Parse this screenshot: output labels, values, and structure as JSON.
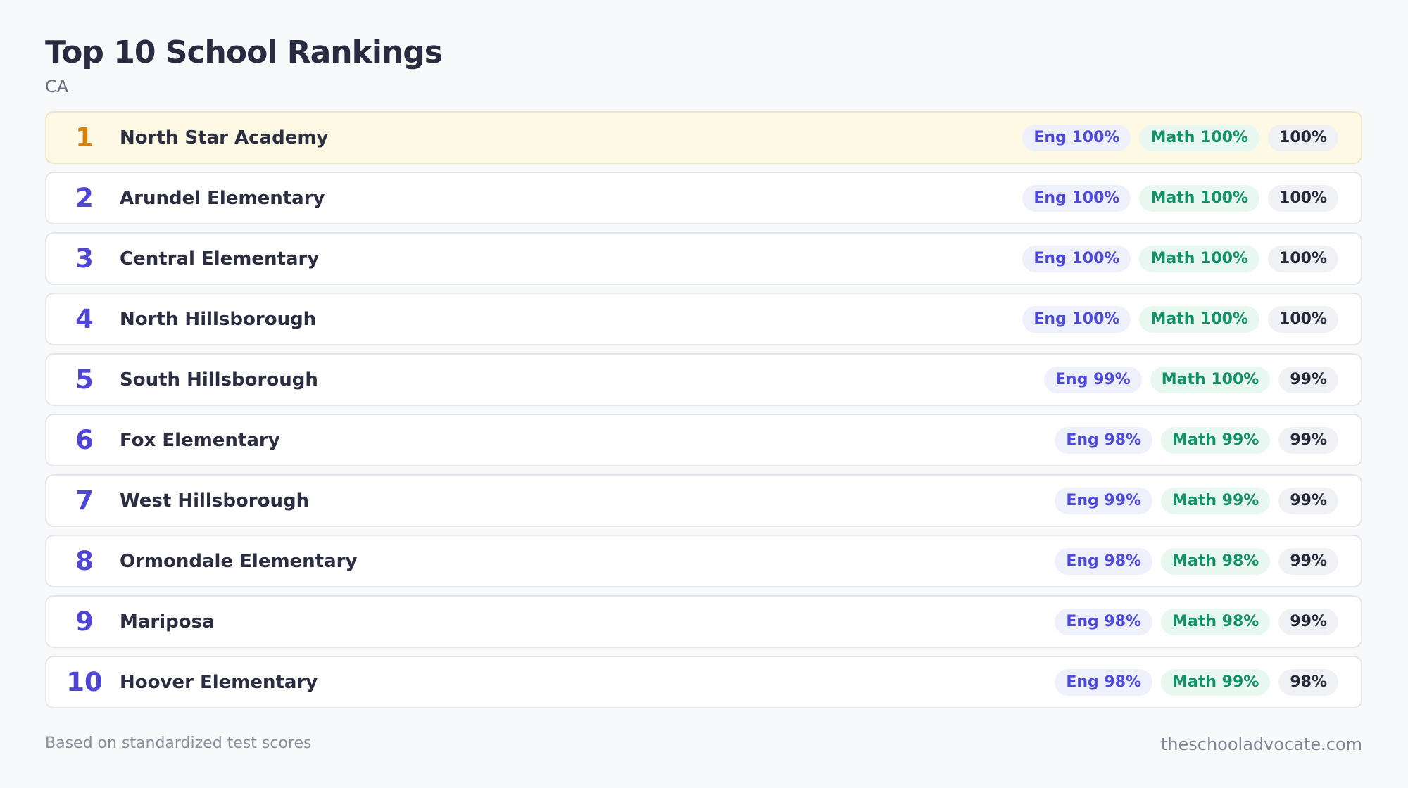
{
  "header": {
    "title": "Top 10 School Rankings",
    "subtitle": "CA"
  },
  "schools": [
    {
      "rank": "1",
      "name": "North Star Academy",
      "eng": "Eng 100%",
      "math": "Math 100%",
      "overall": "100%"
    },
    {
      "rank": "2",
      "name": "Arundel Elementary",
      "eng": "Eng 100%",
      "math": "Math 100%",
      "overall": "100%"
    },
    {
      "rank": "3",
      "name": "Central Elementary",
      "eng": "Eng 100%",
      "math": "Math 100%",
      "overall": "100%"
    },
    {
      "rank": "4",
      "name": "North Hillsborough",
      "eng": "Eng 100%",
      "math": "Math 100%",
      "overall": "100%"
    },
    {
      "rank": "5",
      "name": "South Hillsborough",
      "eng": "Eng 99%",
      "math": "Math 100%",
      "overall": "99%"
    },
    {
      "rank": "6",
      "name": "Fox Elementary",
      "eng": "Eng 98%",
      "math": "Math 99%",
      "overall": "99%"
    },
    {
      "rank": "7",
      "name": "West Hillsborough",
      "eng": "Eng 99%",
      "math": "Math 99%",
      "overall": "99%"
    },
    {
      "rank": "8",
      "name": "Ormondale Elementary",
      "eng": "Eng 98%",
      "math": "Math 98%",
      "overall": "99%"
    },
    {
      "rank": "9",
      "name": "Mariposa",
      "eng": "Eng 98%",
      "math": "Math 98%",
      "overall": "99%"
    },
    {
      "rank": "10",
      "name": "Hoover Elementary",
      "eng": "Eng 98%",
      "math": "Math 99%",
      "overall": "98%"
    }
  ],
  "footer": {
    "note": "Based on standardized test scores",
    "site": "theschooladvocate.com"
  },
  "colors": {
    "rank_accent": "#4f46d8",
    "top_rank_accent": "#d4820f",
    "top_row_background": "#fef9e4",
    "eng_badge_text": "#4d49d8",
    "math_badge_text": "#129067"
  }
}
